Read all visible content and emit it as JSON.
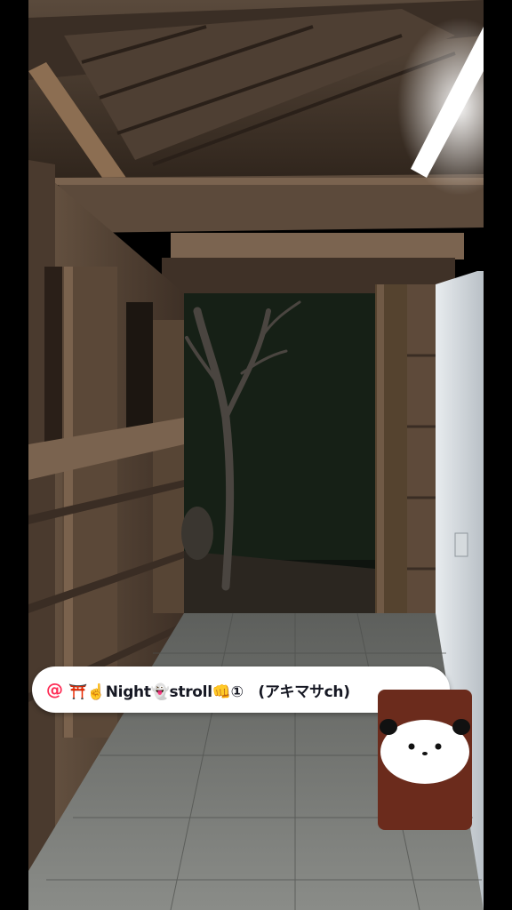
{
  "video": {
    "description_sticker": {
      "mention_symbol": "@",
      "text": "⛩️☝️Night👻stroll👊①　(アキマサch)"
    },
    "panda_sticker_icon": "panda-icon"
  },
  "colors": {
    "mention_red": "#fe2c55",
    "sticker_background": "#ffffff",
    "sticker_text": "#161823",
    "panda_card": "#6b2b1c"
  }
}
